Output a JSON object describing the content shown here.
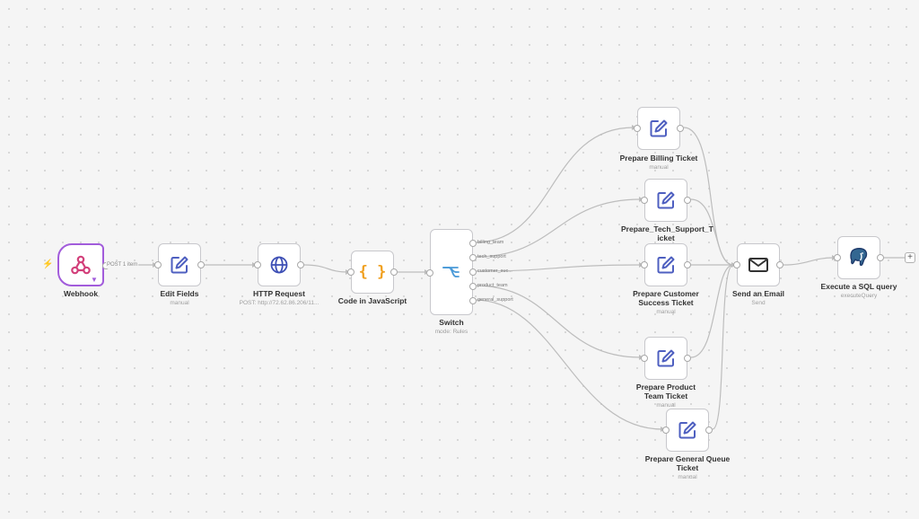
{
  "colors": {
    "webhook_accent": "#a25cdb",
    "edit_icon": "#4e5fc0",
    "http_icon": "#3d4fb5",
    "code_icon": "#f0a020",
    "switch_icon": "#4a9ad8",
    "trigger_bolt": "#f07a3a",
    "wire": "#bdbdbd"
  },
  "nodes": {
    "webhook": {
      "title": "Webhook",
      "icon": "webhook-icon",
      "trigger_icon": "lightning-icon",
      "pin_icon": "pin-icon"
    },
    "edit_fields": {
      "title": "Edit Fields",
      "subtitle": "manual",
      "icon": "pencil-icon"
    },
    "http_request": {
      "title": "HTTP Request",
      "subtitle": "POST: http://72.62.86.206/11...",
      "icon": "globe-icon"
    },
    "code": {
      "title": "Code in JavaScript",
      "icon": "braces-icon"
    },
    "switch": {
      "title": "Switch",
      "subtitle": "mode: Rules",
      "icon": "switch-icon",
      "outputs": [
        "billing_team",
        "tech_support",
        "customer_suc...",
        "product_team",
        "general_support"
      ]
    },
    "prep_billing": {
      "title": "Prepare Billing Ticket",
      "subtitle": "manual",
      "icon": "pencil-icon"
    },
    "prep_tech": {
      "title": "Prepare_Tech_Support_T icket",
      "icon": "pencil-icon"
    },
    "prep_cs": {
      "title": "Prepare Customer Success Ticket",
      "subtitle": "manual",
      "icon": "pencil-icon"
    },
    "prep_product": {
      "title": "Prepare Product Team Ticket",
      "subtitle": "manual",
      "icon": "pencil-icon"
    },
    "prep_general": {
      "title": "Prepare General Queue Ticket",
      "subtitle": "manual",
      "icon": "pencil-icon"
    },
    "send_email": {
      "title": "Send an Email",
      "subtitle": "Send",
      "icon": "envelope-icon"
    },
    "sql": {
      "title": "Execute a SQL query",
      "subtitle": "executeQuery",
      "icon": "postgres-elephant-icon"
    }
  },
  "edges": {
    "webhook_to_edit_label": "POST 1 item"
  },
  "add_button": "+"
}
